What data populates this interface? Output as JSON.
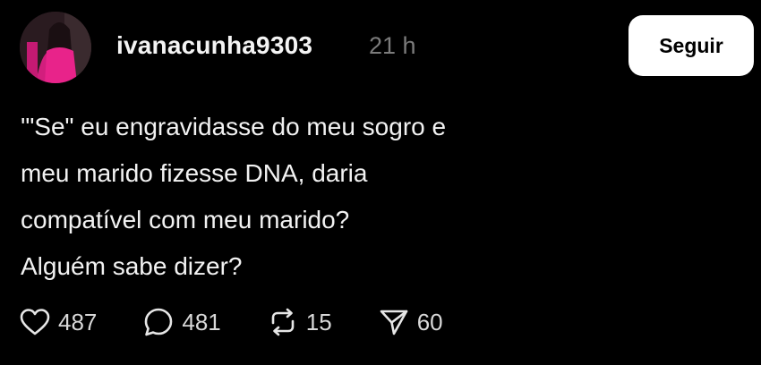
{
  "post": {
    "username": "ivanacunha9303",
    "time": "21 h",
    "follow_label": "Seguir",
    "text_lines": [
      "'\"Se\" eu engravidasse do meu sogro e",
      "meu marido fizesse DNA, daria",
      "compatível com meu marido?",
      "Alguém sabe dizer?"
    ]
  },
  "actions": {
    "likes": "487",
    "comments": "481",
    "reposts": "15",
    "shares": "60"
  },
  "icons": {
    "like": "heart-icon",
    "comment": "comment-bubble-icon",
    "repost": "repost-icon",
    "share": "send-icon"
  },
  "colors": {
    "background": "#000000",
    "text": "#f2f2f2",
    "muted": "#7b7b7b",
    "button_bg": "#ffffff",
    "button_text": "#000000"
  }
}
